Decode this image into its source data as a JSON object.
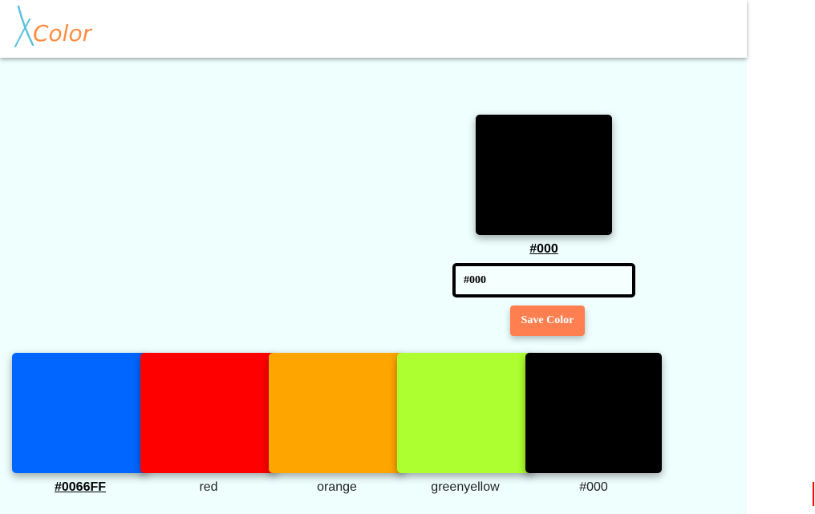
{
  "header": {
    "logo": {
      "text_x": "X",
      "text_rest": "Color",
      "x_color": "#5bc0de",
      "rest_color": "#ff8c42"
    }
  },
  "preview": {
    "color": "#000",
    "label": "#000"
  },
  "input": {
    "value": "#000"
  },
  "save_button": {
    "label": "Save Color",
    "color": "#ff7f50"
  },
  "swatches": [
    {
      "color": "#0066FF",
      "label": "#0066FF",
      "selected": true
    },
    {
      "color": "red",
      "label": "red",
      "selected": false
    },
    {
      "color": "orange",
      "label": "orange",
      "selected": false
    },
    {
      "color": "greenyellow",
      "label": "greenyellow",
      "selected": false
    },
    {
      "color": "#000",
      "label": "#000",
      "selected": false
    }
  ],
  "colors": {
    "background": "#eefffe",
    "header": "#ffffff"
  }
}
